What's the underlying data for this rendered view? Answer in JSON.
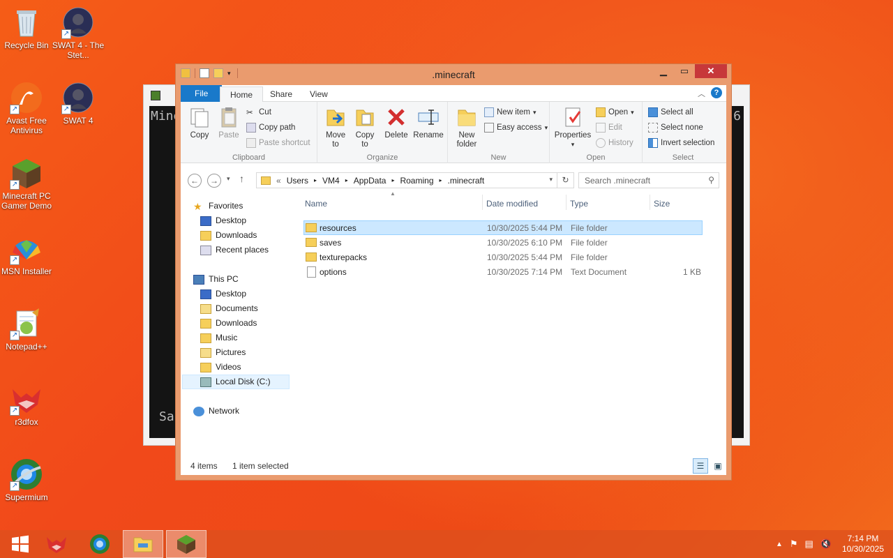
{
  "desktop": {
    "icons": [
      {
        "label": "Recycle Bin",
        "icon": "recycle-bin-icon"
      },
      {
        "label": "SWAT 4 - The Stet...",
        "icon": "swat4-icon"
      },
      {
        "label": "Avast Free Antivirus",
        "icon": "avast-icon"
      },
      {
        "label": "SWAT 4",
        "icon": "swat4-icon"
      },
      {
        "label": "Minecraft PC Gamer Demo",
        "icon": "minecraft-icon"
      },
      {
        "label": "MSN Installer",
        "icon": "msn-icon"
      },
      {
        "label": "Notepad++",
        "icon": "notepadpp-icon"
      },
      {
        "label": "r3dfox",
        "icon": "r3dfox-icon"
      },
      {
        "label": "Supermium",
        "icon": "supermium-icon"
      }
    ],
    "background_window_text": [
      "Mine",
      "Sa",
      "6"
    ]
  },
  "explorer": {
    "title": ".minecraft",
    "tabs": [
      "File",
      "Home",
      "Share",
      "View"
    ],
    "ribbon": {
      "clipboard": {
        "label": "Clipboard",
        "copy": "Copy",
        "paste": "Paste",
        "cut": "Cut",
        "copy_path": "Copy path",
        "paste_shortcut": "Paste shortcut"
      },
      "organize": {
        "label": "Organize",
        "move_to": "Move to",
        "copy_to": "Copy to",
        "delete": "Delete",
        "rename": "Rename"
      },
      "new": {
        "label": "New",
        "new_folder": "New folder",
        "new_item": "New item",
        "easy_access": "Easy access"
      },
      "open": {
        "label": "Open",
        "properties": "Properties",
        "open": "Open",
        "edit": "Edit",
        "history": "History"
      },
      "select": {
        "label": "Select",
        "select_all": "Select all",
        "select_none": "Select none",
        "invert_selection": "Invert selection"
      }
    },
    "address": {
      "prefix": "«",
      "crumbs": [
        "Users",
        "VM4",
        "AppData",
        "Roaming",
        ".minecraft"
      ],
      "search_placeholder": "Search .minecraft"
    },
    "nav": {
      "favorites": "Favorites",
      "favorite_items": [
        "Desktop",
        "Downloads",
        "Recent places"
      ],
      "this_pc": "This PC",
      "pc_items": [
        "Desktop",
        "Documents",
        "Downloads",
        "Music",
        "Pictures",
        "Videos",
        "Local Disk (C:)"
      ],
      "network": "Network"
    },
    "columns": {
      "name": "Name",
      "date": "Date modified",
      "type": "Type",
      "size": "Size"
    },
    "files": [
      {
        "name": "resources",
        "date": "10/30/2025 5:44 PM",
        "type": "File folder",
        "size": "",
        "selected": true
      },
      {
        "name": "saves",
        "date": "10/30/2025 6:10 PM",
        "type": "File folder",
        "size": "",
        "selected": false
      },
      {
        "name": "texturepacks",
        "date": "10/30/2025 5:44 PM",
        "type": "File folder",
        "size": "",
        "selected": false
      },
      {
        "name": "options",
        "date": "10/30/2025 7:14 PM",
        "type": "Text Document",
        "size": "1 KB",
        "selected": false
      }
    ],
    "status": {
      "items": "4 items",
      "selected": "1 item selected"
    }
  },
  "taskbar": {
    "time": "7:14 PM",
    "date": "10/30/2025"
  }
}
